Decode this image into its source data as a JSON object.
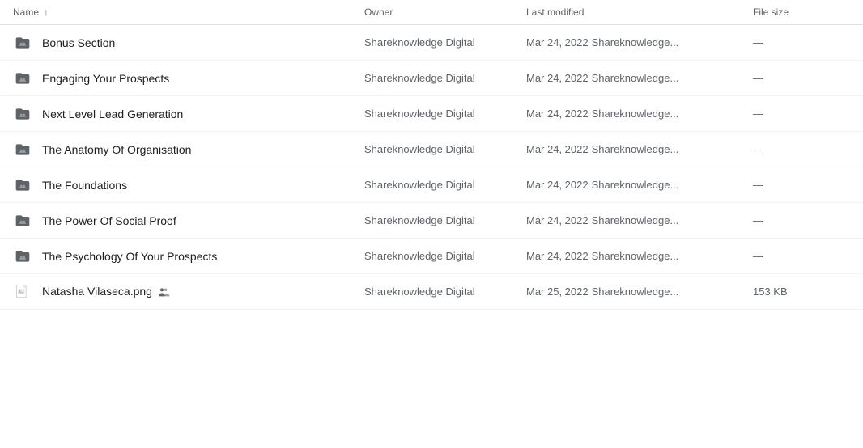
{
  "header": {
    "name_label": "Name",
    "sort_arrow": "↑",
    "owner_label": "Owner",
    "modified_label": "Last modified",
    "size_label": "File size"
  },
  "rows": [
    {
      "id": "bonus-section",
      "type": "folder",
      "name": "Bonus Section",
      "owner": "Shareknowledge Digital",
      "modified_date": "Mar 24, 2022",
      "modified_by": "Shareknowledge...",
      "size": "—",
      "shared": false
    },
    {
      "id": "engaging-prospects",
      "type": "folder",
      "name": "Engaging Your Prospects",
      "owner": "Shareknowledge Digital",
      "modified_date": "Mar 24, 2022",
      "modified_by": "Shareknowledge...",
      "size": "—",
      "shared": false
    },
    {
      "id": "next-level",
      "type": "folder",
      "name": "Next Level Lead Generation",
      "owner": "Shareknowledge Digital",
      "modified_date": "Mar 24, 2022",
      "modified_by": "Shareknowledge...",
      "size": "—",
      "shared": false
    },
    {
      "id": "anatomy",
      "type": "folder",
      "name": "The Anatomy Of Organisation",
      "owner": "Shareknowledge Digital",
      "modified_date": "Mar 24, 2022",
      "modified_by": "Shareknowledge...",
      "size": "—",
      "shared": false
    },
    {
      "id": "foundations",
      "type": "folder",
      "name": "The Foundations",
      "owner": "Shareknowledge Digital",
      "modified_date": "Mar 24, 2022",
      "modified_by": "Shareknowledge...",
      "size": "—",
      "shared": false
    },
    {
      "id": "social-proof",
      "type": "folder",
      "name": "The Power Of Social Proof",
      "owner": "Shareknowledge Digital",
      "modified_date": "Mar 24, 2022",
      "modified_by": "Shareknowledge...",
      "size": "—",
      "shared": false
    },
    {
      "id": "psychology",
      "type": "folder",
      "name": "The Psychology Of Your Prospects",
      "owner": "Shareknowledge Digital",
      "modified_date": "Mar 24, 2022",
      "modified_by": "Shareknowledge...",
      "size": "—",
      "shared": false
    },
    {
      "id": "natasha-png",
      "type": "image",
      "name": "Natasha Vilaseca.png",
      "owner": "Shareknowledge Digital",
      "modified_date": "Mar 25, 2022",
      "modified_by": "Shareknowledge...",
      "size": "153 KB",
      "shared": true
    }
  ]
}
